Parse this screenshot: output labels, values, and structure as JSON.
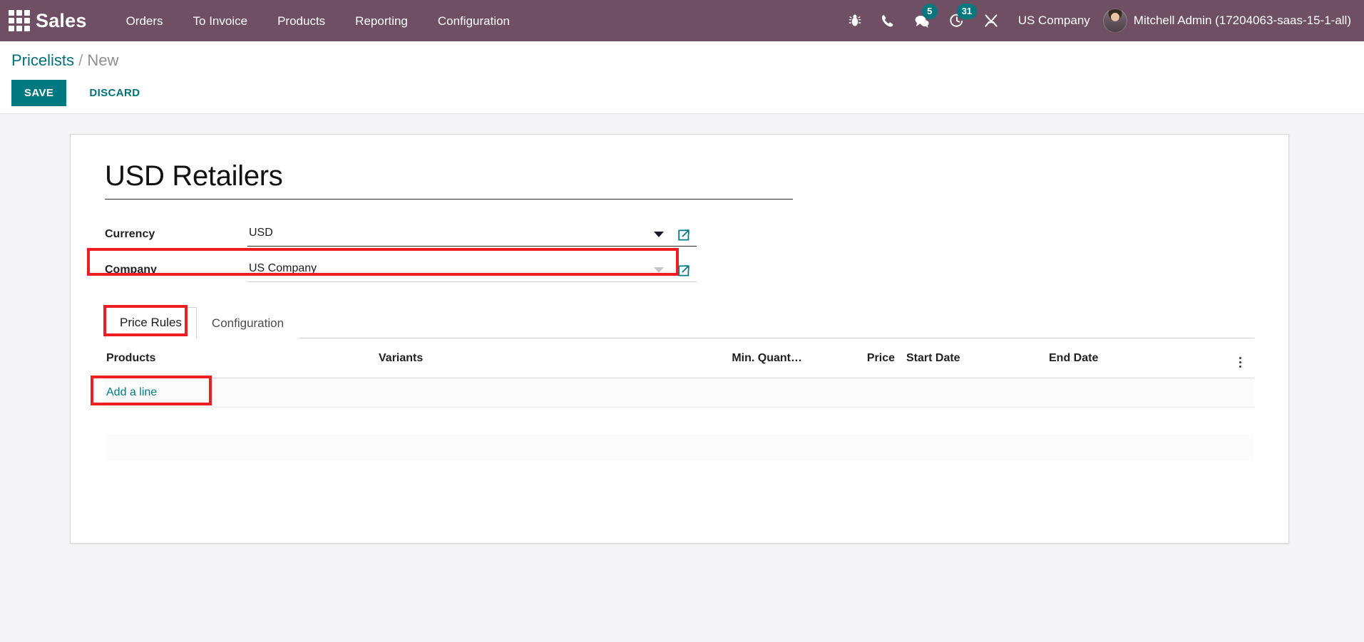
{
  "navbar": {
    "apps_icon": "apps-grid-icon",
    "brand": "Sales",
    "menu": [
      {
        "label": "Orders"
      },
      {
        "label": "To Invoice"
      },
      {
        "label": "Products"
      },
      {
        "label": "Reporting"
      },
      {
        "label": "Configuration"
      }
    ],
    "sys_icons": [
      {
        "name": "bug-icon",
        "badge": ""
      },
      {
        "name": "phone-icon",
        "badge": ""
      },
      {
        "name": "messages-icon",
        "badge": "5"
      },
      {
        "name": "activities-clock-icon",
        "badge": "31"
      },
      {
        "name": "tools-wrench-icon",
        "badge": ""
      }
    ],
    "company": "US Company",
    "user": "Mitchell Admin (17204063-saas-15-1-all)",
    "bg_color": "#6f4f63",
    "badge_color": "#00787f"
  },
  "control_panel": {
    "breadcrumb_root": "Pricelists",
    "breadcrumb_sep": "/",
    "breadcrumb_current": "New",
    "save_label": "SAVE",
    "discard_label": "DISCARD",
    "accent_color": "#00787f"
  },
  "form": {
    "title": "USD Retailers",
    "title_placeholder": "e.g. USD Retailers",
    "fields": [
      {
        "label": "Currency",
        "value": "USD",
        "placeholder": "Currency",
        "caret": "dark",
        "highlighted": false
      },
      {
        "label": "Company",
        "value": "US Company",
        "placeholder": "Company",
        "caret": "light",
        "highlighted": true
      }
    ],
    "external_link_icon": "external-link-icon",
    "highlight_color": "#ee1d23"
  },
  "notebook": {
    "tabs": [
      {
        "label": "Price Rules",
        "active": true,
        "highlighted": true
      },
      {
        "label": "Configuration",
        "active": false,
        "highlighted": false
      }
    ]
  },
  "price_rules_table": {
    "columns": [
      {
        "label": "Products",
        "align": "left"
      },
      {
        "label": "Variants",
        "align": "left"
      },
      {
        "label": "Min. Quant…",
        "align": "right"
      },
      {
        "label": "Price",
        "align": "right"
      },
      {
        "label": "Start Date",
        "align": "left"
      },
      {
        "label": "End Date",
        "align": "left"
      }
    ],
    "options_icon": "vertical-dots-icon",
    "add_line_label": "Add a line",
    "rows": []
  }
}
